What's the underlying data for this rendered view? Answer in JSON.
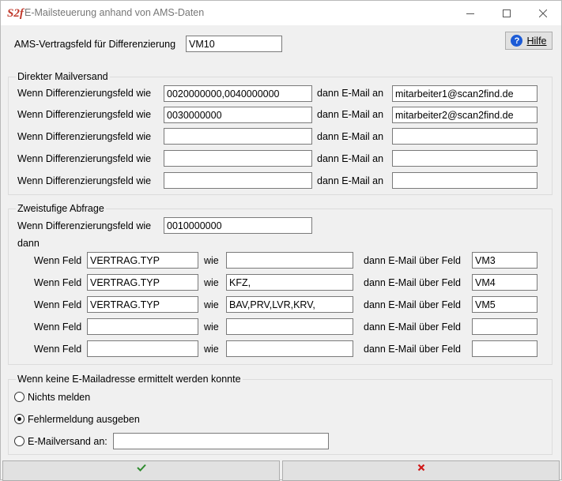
{
  "window": {
    "title": "E-Mailsteuerung anhand von AMS-Daten",
    "logo_text": "S2f"
  },
  "header": {
    "contract_field_label": "AMS-Vertragsfeld für Differenzierung",
    "contract_field_value": "VM10",
    "help_label": "Hilfe"
  },
  "direct": {
    "title": "Direkter Mailversand",
    "rows": [
      {
        "label": "Wenn Differenzierungsfeld wie",
        "value": "0020000000,0040000000",
        "mid": "dann E-Mail an",
        "email": "mitarbeiter1@scan2find.de"
      },
      {
        "label": "Wenn Differenzierungsfeld wie",
        "value": "0030000000",
        "mid": "dann E-Mail an",
        "email": "mitarbeiter2@scan2find.de"
      },
      {
        "label": "Wenn Differenzierungsfeld wie",
        "value": "",
        "mid": "dann E-Mail an",
        "email": ""
      },
      {
        "label": "Wenn Differenzierungsfeld wie",
        "value": "",
        "mid": "dann E-Mail an",
        "email": ""
      },
      {
        "label": "Wenn Differenzierungsfeld wie",
        "value": "",
        "mid": "dann E-Mail an",
        "email": ""
      }
    ]
  },
  "twostep": {
    "title": "Zweistufige Abfrage",
    "diff_label": "Wenn Differenzierungsfeld wie",
    "diff_value": "0010000000",
    "dann_label": "dann",
    "rows": [
      {
        "label": "Wenn Feld",
        "field": "VERTRAG.TYP",
        "wie": "wie",
        "value": "",
        "mid": "dann E-Mail über Feld",
        "target": "VM3"
      },
      {
        "label": "Wenn Feld",
        "field": "VERTRAG.TYP",
        "wie": "wie",
        "value": "KFZ,",
        "mid": "dann E-Mail über Feld",
        "target": "VM4"
      },
      {
        "label": "Wenn Feld",
        "field": "VERTRAG.TYP",
        "wie": "wie",
        "value": "BAV,PRV,LVR,KRV,",
        "mid": "dann E-Mail über Feld",
        "target": "VM5"
      },
      {
        "label": "Wenn Feld",
        "field": "",
        "wie": "wie",
        "value": "",
        "mid": "dann E-Mail über Feld",
        "target": ""
      },
      {
        "label": "Wenn Feld",
        "field": "",
        "wie": "wie",
        "value": "",
        "mid": "dann E-Mail über Feld",
        "target": ""
      }
    ]
  },
  "fallback": {
    "title": "Wenn keine E-Mailadresse ermittelt werden konnte",
    "options": [
      {
        "label": "Nichts melden",
        "checked": false
      },
      {
        "label": "Fehlermeldung ausgeben",
        "checked": true
      },
      {
        "label": "E-Mailversand an:",
        "checked": false
      }
    ],
    "email_value": ""
  },
  "buttons": {
    "ok_icon": "checkmark-icon",
    "cancel_icon": "x-icon",
    "ok_color": "#2e8b2e",
    "cancel_color": "#d01818"
  }
}
